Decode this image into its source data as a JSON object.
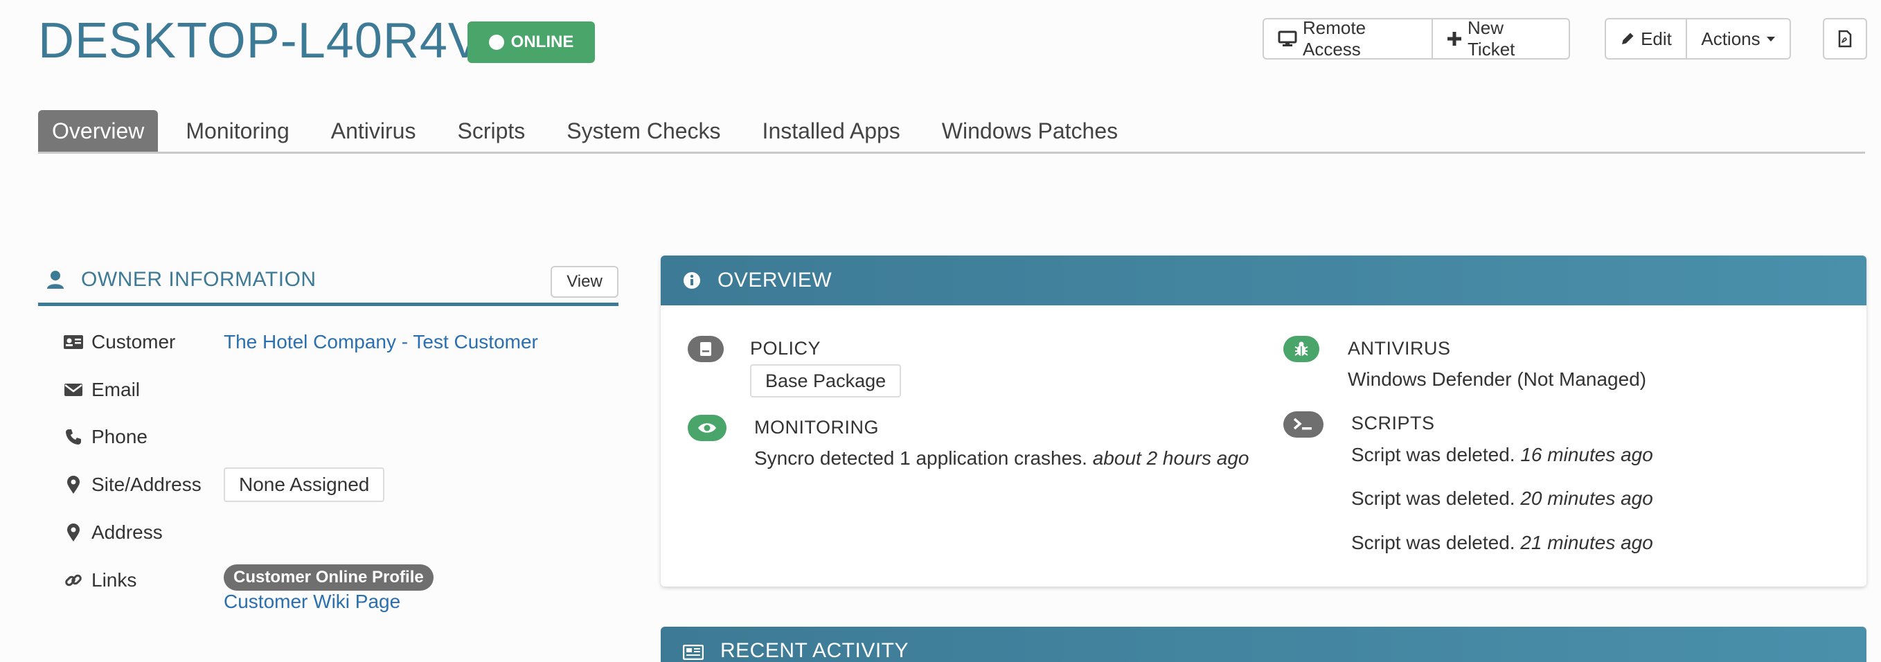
{
  "header": {
    "device_name": "DESKTOP-L40R4VJ",
    "status": "ONLINE",
    "buttons": {
      "remote_access": "Remote Access",
      "new_ticket": "New Ticket",
      "edit": "Edit",
      "actions": "Actions"
    }
  },
  "tabs": [
    {
      "label": "Overview",
      "active": true
    },
    {
      "label": "Monitoring"
    },
    {
      "label": "Antivirus"
    },
    {
      "label": "Scripts"
    },
    {
      "label": "System Checks"
    },
    {
      "label": "Installed Apps"
    },
    {
      "label": "Windows Patches"
    }
  ],
  "owner": {
    "title": "OWNER INFORMATION",
    "view_label": "View",
    "customer_label": "Customer",
    "customer_value": "The Hotel Company - Test Customer",
    "email_label": "Email",
    "phone_label": "Phone",
    "site_label": "Site/Address",
    "site_value": "None Assigned",
    "address_label": "Address",
    "links_label": "Links",
    "links": [
      "Customer Online Profile",
      "Customer Wiki Page"
    ]
  },
  "overview": {
    "title": "OVERVIEW",
    "policy_label": "POLICY",
    "policy_value": "Base Package",
    "monitoring_label": "MONITORING",
    "monitoring_text": "Syncro detected 1 application crashes.",
    "monitoring_time": "about 2 hours ago",
    "antivirus_label": "ANTIVIRUS",
    "antivirus_value": "Windows Defender (Not Managed)",
    "scripts_label": "SCRIPTS",
    "scripts": [
      {
        "text": "Script was deleted.",
        "time": "16 minutes ago"
      },
      {
        "text": "Script was deleted.",
        "time": "20 minutes ago"
      },
      {
        "text": "Script was deleted.",
        "time": "21 minutes ago"
      }
    ]
  },
  "recent_activity": {
    "title": "RECENT ACTIVITY"
  },
  "colors": {
    "brand": "#3d7a95",
    "online": "#4aa56a",
    "link": "#2a6fb0",
    "active_tab": "#777777",
    "icon_gray": "#6f6f6f"
  }
}
